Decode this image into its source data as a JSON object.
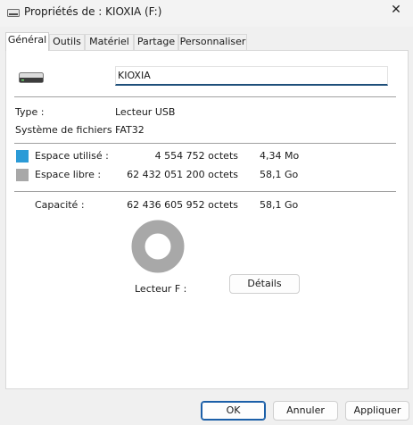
{
  "window": {
    "title": "Propriétés de : KIOXIA (F:)",
    "close_label": "✕"
  },
  "tabs": [
    {
      "label": "Général",
      "active": true
    },
    {
      "label": "Outils",
      "active": false
    },
    {
      "label": "Matériel",
      "active": false
    },
    {
      "label": "Partage",
      "active": false
    },
    {
      "label": "Personnaliser",
      "active": false
    }
  ],
  "general": {
    "volume_name": "KIOXIA",
    "type_label": "Type :",
    "type_value": "Lecteur USB",
    "fs_label": "Système de fichiers :",
    "fs_value": "FAT32",
    "used_label": "Espace utilisé :",
    "used_bytes": "4 554 752 octets",
    "used_short": "4,34 Mo",
    "free_label": "Espace libre :",
    "free_bytes": "62 432 051 200 octets",
    "free_short": "58,1 Go",
    "capacity_label": "Capacité :",
    "capacity_bytes": "62 436 605 952 octets",
    "capacity_short": "58,1 Go",
    "drive_label": "Lecteur F :",
    "details_button": "Détails",
    "used_fraction": 7.3e-05
  },
  "colors": {
    "used": "#2b9bd7",
    "free": "#a8a8a8"
  },
  "footer": {
    "ok": "OK",
    "cancel": "Annuler",
    "apply": "Appliquer"
  }
}
